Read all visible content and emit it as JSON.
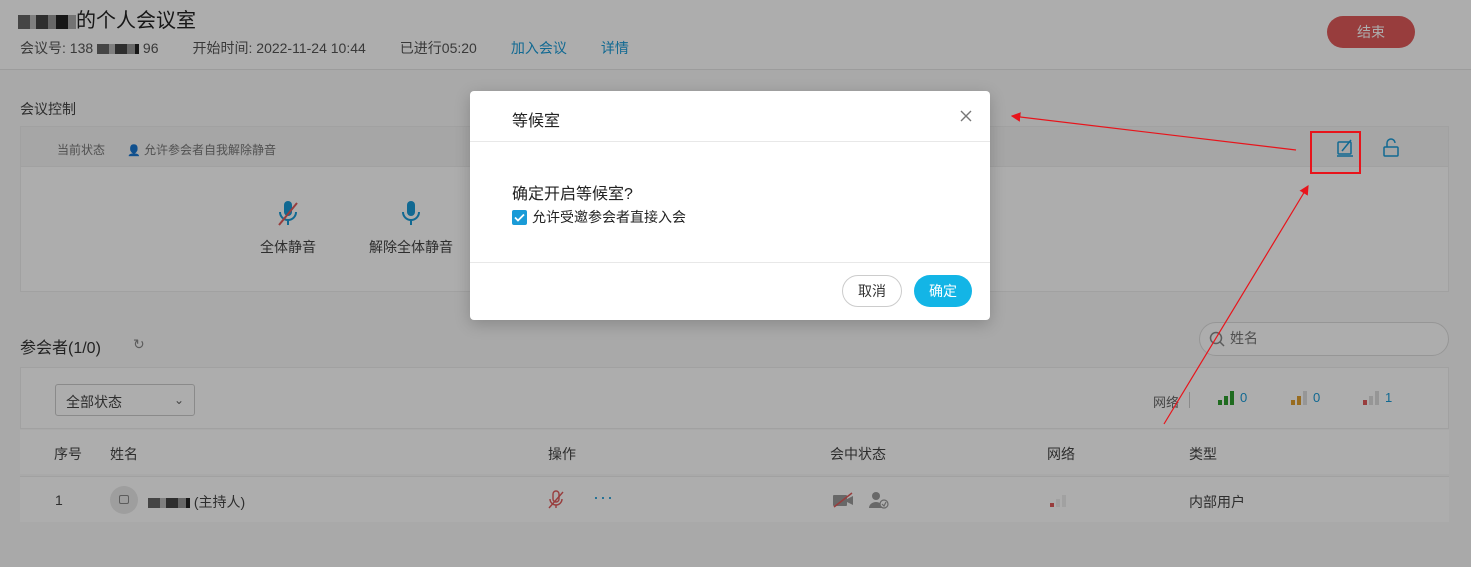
{
  "header": {
    "title_suffix": "的个人会议室",
    "meeting_id_label": "会议号: 138",
    "meeting_id_tail": "96",
    "start_time": "开始时间: 2022-11-24 10:44",
    "elapsed": "已进行05:20",
    "join_link": "加入会议",
    "details_link": "详情",
    "end_button": "结束"
  },
  "controls": {
    "section_label": "会议控制",
    "status_label": "当前状态",
    "status_value": "允许参会者自我解除静音",
    "mute_all": "全体静音",
    "unmute_all": "解除全体静音"
  },
  "participants": {
    "title": "参会者(1/0)",
    "search_placeholder": "姓名",
    "filter_value": "全部状态",
    "network_label": "网络",
    "network_counts": {
      "good": "0",
      "medium": "0",
      "poor": "1"
    },
    "columns": [
      "序号",
      "姓名",
      "操作",
      "会中状态",
      "网络",
      "类型"
    ],
    "rows": [
      {
        "index": "1",
        "name_suffix": "(主持人)",
        "more": "···",
        "type": "内部用户"
      }
    ]
  },
  "dialog": {
    "title": "等候室",
    "question": "确定开启等候室?",
    "checkbox_label": "允许受邀参会者直接入会",
    "checkbox_checked": true,
    "cancel": "取消",
    "confirm": "确定"
  },
  "colors": {
    "accent": "#1a9bd7",
    "end_button": "#e05a5a",
    "confirm_button": "#13b5e6",
    "annotation": "#e8141b"
  }
}
